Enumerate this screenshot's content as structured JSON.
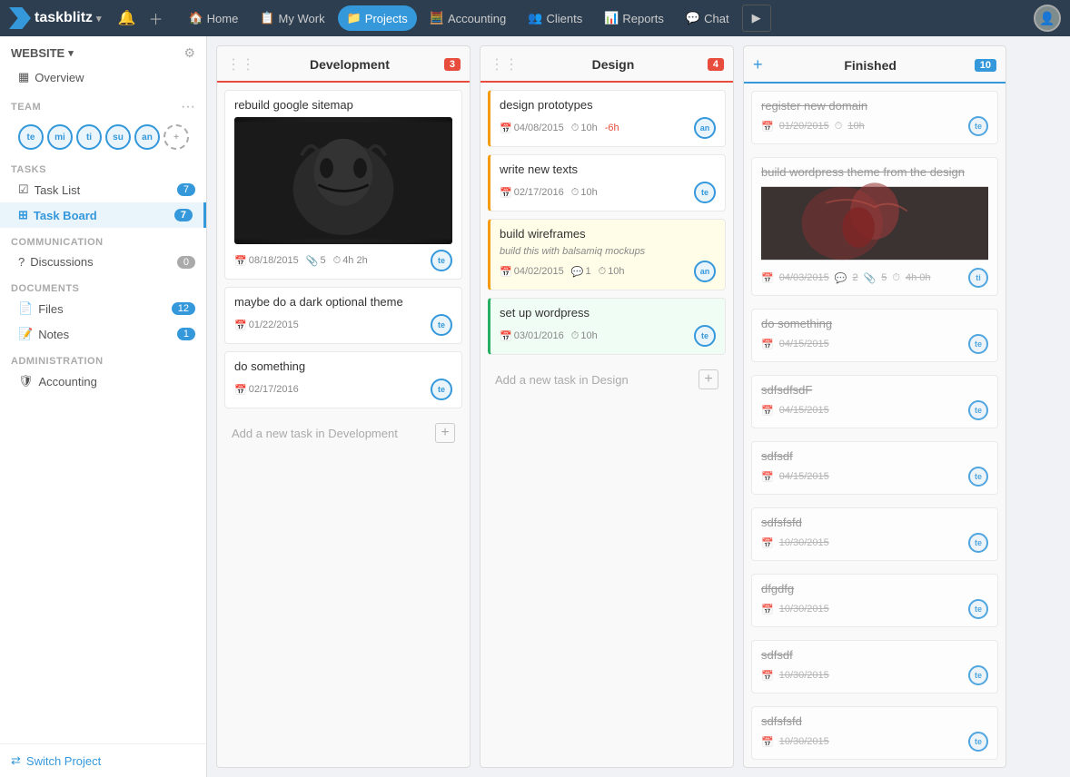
{
  "app": {
    "name": "taskblitz",
    "logo_symbol": "▶"
  },
  "nav": {
    "items": [
      {
        "id": "home",
        "label": "Home",
        "icon": "🏠",
        "active": false
      },
      {
        "id": "mywork",
        "label": "My Work",
        "icon": "📋",
        "active": false
      },
      {
        "id": "projects",
        "label": "Projects",
        "icon": "📁",
        "active": true
      },
      {
        "id": "accounting",
        "label": "Accounting",
        "icon": "🧮",
        "active": false
      },
      {
        "id": "clients",
        "label": "Clients",
        "icon": "👥",
        "active": false
      },
      {
        "id": "reports",
        "label": "Reports",
        "icon": "📊",
        "active": false
      },
      {
        "id": "chat",
        "label": "Chat",
        "icon": "💬",
        "active": false
      }
    ],
    "play_button": "▶"
  },
  "sidebar": {
    "website_label": "WEBSITE",
    "overview_label": "Overview",
    "team_label": "TEAM",
    "team_members": [
      {
        "initials": "te"
      },
      {
        "initials": "mi"
      },
      {
        "initials": "ti"
      },
      {
        "initials": "su"
      },
      {
        "initials": "an"
      }
    ],
    "tasks_label": "TASKS",
    "task_list_label": "Task List",
    "task_list_count": "7",
    "task_board_label": "Task Board",
    "task_board_count": "7",
    "communication_label": "COMMUNICATION",
    "discussions_label": "Discussions",
    "discussions_count": "0",
    "documents_label": "DOCUMENTS",
    "files_label": "Files",
    "files_count": "12",
    "notes_label": "Notes",
    "notes_count": "1",
    "admin_label": "ADMINISTRATION",
    "accounting_label": "Accounting",
    "switch_project_label": "Switch Project"
  },
  "board": {
    "columns": [
      {
        "id": "development",
        "title": "Development",
        "count": "3",
        "cards": [
          {
            "id": "dev1",
            "title": "rebuild google sitemap",
            "has_image": true,
            "image_type": "monster",
            "date": "08/18/2015",
            "attachments": "5",
            "time": "4h 2h",
            "assignee": "te",
            "border_color": "none"
          },
          {
            "id": "dev2",
            "title": "maybe do a dark optional theme",
            "has_image": false,
            "date": "01/22/2015",
            "assignee": "te",
            "border_color": "none"
          },
          {
            "id": "dev3",
            "title": "do something",
            "has_image": false,
            "date": "02/17/2016",
            "assignee": "te",
            "border_color": "none"
          }
        ],
        "add_task_label": "Add a new task in Development"
      },
      {
        "id": "design",
        "title": "Design",
        "count": "4",
        "cards": [
          {
            "id": "des1",
            "title": "design prototypes",
            "has_image": false,
            "date": "04/08/2015",
            "time": "10h",
            "time_over": "-6h",
            "assignee": "an",
            "border_color": "yellow"
          },
          {
            "id": "des2",
            "title": "write new texts",
            "has_image": false,
            "date": "02/17/2016",
            "time": "10h",
            "assignee": "te",
            "border_color": "yellow"
          },
          {
            "id": "des3",
            "title": "build wireframes",
            "desc": "build this with balsamiq mockups",
            "has_image": false,
            "date": "04/02/2015",
            "comments": "1",
            "time": "10h",
            "assignee": "an",
            "border_color": "yellow"
          },
          {
            "id": "des4",
            "title": "set up wordpress",
            "has_image": false,
            "date": "03/01/2016",
            "time": "10h",
            "assignee": "te",
            "border_color": "green"
          }
        ],
        "add_task_label": "Add a new task in Design"
      }
    ],
    "finished_column": {
      "title": "Finished",
      "count": "10",
      "cards": [
        {
          "id": "fin1",
          "title": "register new domain",
          "date": "01/20/2015",
          "time": "10h",
          "assignee": "te",
          "has_image": false
        },
        {
          "id": "fin2",
          "title": "build wordpress theme from the design",
          "date": "04/03/2015",
          "comments": "2",
          "attachments": "5",
          "time": "4h 0h",
          "assignee": "ti",
          "has_image": true,
          "image_type": "red"
        },
        {
          "id": "fin3",
          "title": "do something",
          "date": "04/15/2015",
          "assignee": "te",
          "has_image": false
        },
        {
          "id": "fin4",
          "title": "sdfsdfsdF",
          "date": "04/15/2015",
          "assignee": "te",
          "has_image": false
        },
        {
          "id": "fin5",
          "title": "sdfsdf",
          "date": "04/15/2015",
          "assignee": "te",
          "has_image": false
        },
        {
          "id": "fin6",
          "title": "sdfsfsfd",
          "date": "10/30/2015",
          "assignee": "te",
          "has_image": false
        },
        {
          "id": "fin7",
          "title": "dfgdfg",
          "date": "10/30/2015",
          "assignee": "te",
          "has_image": false
        },
        {
          "id": "fin8",
          "title": "sdfsdf",
          "date": "10/30/2015",
          "assignee": "te",
          "has_image": false
        },
        {
          "id": "fin9",
          "title": "sdfsfsfd",
          "date": "10/30/2015",
          "assignee": "te",
          "has_image": false
        }
      ]
    }
  }
}
